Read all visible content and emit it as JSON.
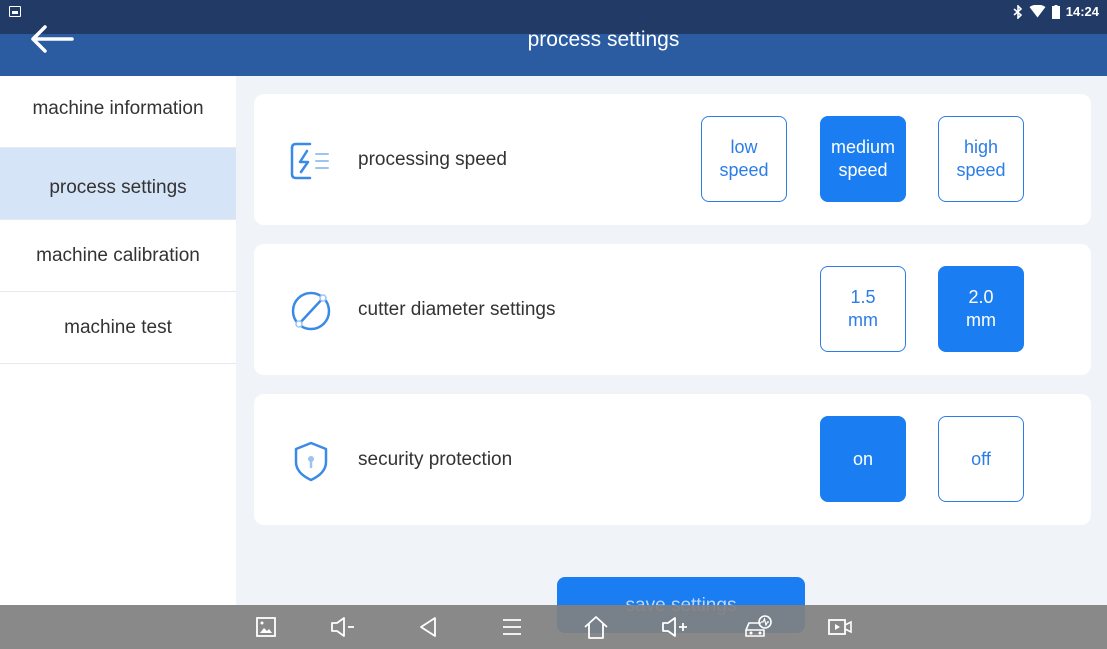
{
  "status": {
    "time": "14:24"
  },
  "header": {
    "title": "process settings"
  },
  "sidebar": {
    "items": [
      {
        "label": "machine information"
      },
      {
        "label": "process settings"
      },
      {
        "label": "machine calibration"
      },
      {
        "label": "machine test"
      }
    ],
    "active_index": 1
  },
  "settings": {
    "speed": {
      "label": "processing speed",
      "options": [
        {
          "line1": "low",
          "line2": "speed"
        },
        {
          "line1": "medium",
          "line2": "speed"
        },
        {
          "line1": "high",
          "line2": "speed"
        }
      ],
      "selected": "medium speed"
    },
    "cutter": {
      "label": "cutter diameter settings",
      "options": [
        {
          "line1": "1.5",
          "line2": "mm"
        },
        {
          "line1": "2.0",
          "line2": "mm"
        }
      ],
      "selected": "2.0 mm"
    },
    "security": {
      "label": "security protection",
      "options": [
        {
          "line1": "on"
        },
        {
          "line1": "off"
        }
      ],
      "selected": "on"
    }
  },
  "footer": {
    "save_label": "save settings"
  },
  "colors": {
    "header": "#2b5ba0",
    "statusbar": "#213a66",
    "accent": "#1a7df2",
    "sidebar_active": "#d6e4f7"
  },
  "navbar": {
    "icons": [
      "screenshot-icon",
      "volume-down-icon",
      "back-icon",
      "menu-icon",
      "home-icon",
      "volume-up-icon",
      "car-diagnostic-icon",
      "screen-record-icon"
    ]
  }
}
